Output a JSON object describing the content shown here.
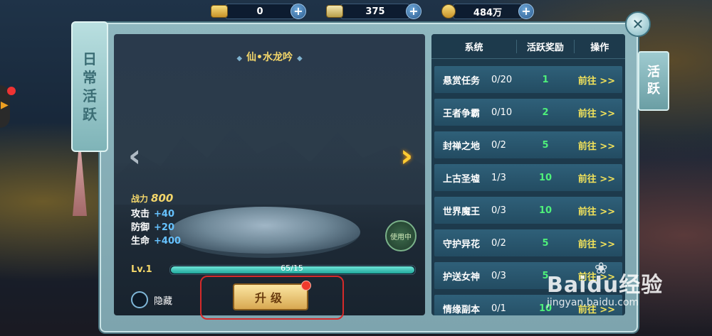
{
  "currency": [
    {
      "icon": "gold-ingot-icon",
      "value": "0"
    },
    {
      "icon": "silver-ingot-icon",
      "value": "375"
    },
    {
      "icon": "copper-coin-icon",
      "value": "484万"
    }
  ],
  "left_banner": {
    "title": [
      "日",
      "常",
      "活",
      "跃"
    ]
  },
  "right_tab": {
    "label": [
      "活",
      "跃"
    ]
  },
  "preview": {
    "title": "仙•水龙吟",
    "power_label": "战力",
    "power_value": "800",
    "stats": [
      {
        "label": "攻击",
        "value": "+40"
      },
      {
        "label": "防御",
        "value": "+20"
      },
      {
        "label": "生命",
        "value": "+400"
      }
    ],
    "in_use": "使用中",
    "level": "Lv.1",
    "progress_text": "65/15",
    "progress_fraction": 1.0,
    "hide_label": "隐藏",
    "upgrade_label": "升级"
  },
  "table": {
    "headers": [
      "系统",
      "活跃奖励",
      "操作"
    ],
    "rows": [
      {
        "name": "悬赏任务",
        "progress": "0/20",
        "reward": "1",
        "action": "前往 >>"
      },
      {
        "name": "王者争霸",
        "progress": "0/10",
        "reward": "2",
        "action": "前往 >>"
      },
      {
        "name": "封禅之地",
        "progress": "0/2",
        "reward": "5",
        "action": "前往 >>"
      },
      {
        "name": "上古圣墟",
        "progress": "1/3",
        "reward": "10",
        "action": "前往 >>"
      },
      {
        "name": "世界魔王",
        "progress": "0/3",
        "reward": "10",
        "action": "前往 >>"
      },
      {
        "name": "守护异花",
        "progress": "0/2",
        "reward": "5",
        "action": "前往 >>"
      },
      {
        "name": "护送女神",
        "progress": "0/3",
        "reward": "5",
        "action": "前往 >>"
      },
      {
        "name": "情缘副本",
        "progress": "0/1",
        "reward": "10",
        "action": "前往 >>"
      }
    ]
  },
  "watermark": {
    "brand": "Baidu经验",
    "url": "jingyan.baidu.com"
  },
  "colors": {
    "accent_gold": "#f3d66a",
    "reward_green": "#4ef07a",
    "highlight_red": "#d52a2a"
  }
}
